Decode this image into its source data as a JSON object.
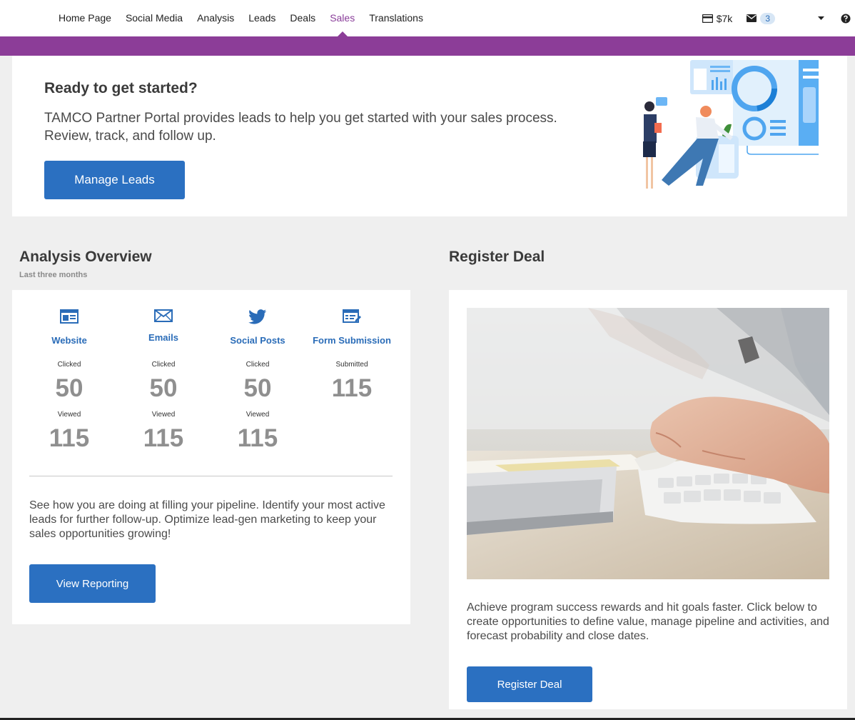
{
  "nav": {
    "items": [
      {
        "label": "Home Page"
      },
      {
        "label": "Social Media"
      },
      {
        "label": "Analysis"
      },
      {
        "label": "Leads"
      },
      {
        "label": "Deals"
      },
      {
        "label": "Sales",
        "active": true
      },
      {
        "label": "Translations"
      }
    ],
    "credit": "$7k",
    "mail_count": "3"
  },
  "colors": {
    "brand_purple": "#8c3d98",
    "primary_blue": "#2b70c1",
    "link_blue": "#2a6cb8",
    "metric_gray": "#8f8f8f"
  },
  "hero": {
    "title": "Ready to get started?",
    "text": "TAMCO Partner Portal provides leads to help you get started with your sales process. Review, track, and follow up.",
    "button": "Manage Leads"
  },
  "analysis": {
    "title": "Analysis Overview",
    "subtitle": "Last three months",
    "metrics": [
      {
        "icon": "website-icon",
        "label": "Website",
        "stat1_label": "Clicked",
        "stat1_value": "50",
        "stat2_label": "Viewed",
        "stat2_value": "115"
      },
      {
        "icon": "email-icon",
        "label": "Emails",
        "stat1_label": "Clicked",
        "stat1_value": "50",
        "stat2_label": "Viewed",
        "stat2_value": "115"
      },
      {
        "icon": "twitter-icon",
        "label": "Social Posts",
        "stat1_label": "Clicked",
        "stat1_value": "50",
        "stat2_label": "Viewed",
        "stat2_value": "115"
      },
      {
        "icon": "form-icon",
        "label": "Form Submission",
        "stat1_label": "Submitted",
        "stat1_value": "115"
      }
    ],
    "text": "See how you are doing at filling your pipeline. Identify your most active leads for further follow-up. Optimize lead-gen marketing to keep your sales opportunities growing!",
    "button": "View Reporting"
  },
  "deal": {
    "title": "Register Deal",
    "text": "Achieve program success rewards and hit goals faster. Click below to create opportunities to define value, manage pipeline and activities, and forecast probability and close dates.",
    "button": "Register Deal"
  }
}
